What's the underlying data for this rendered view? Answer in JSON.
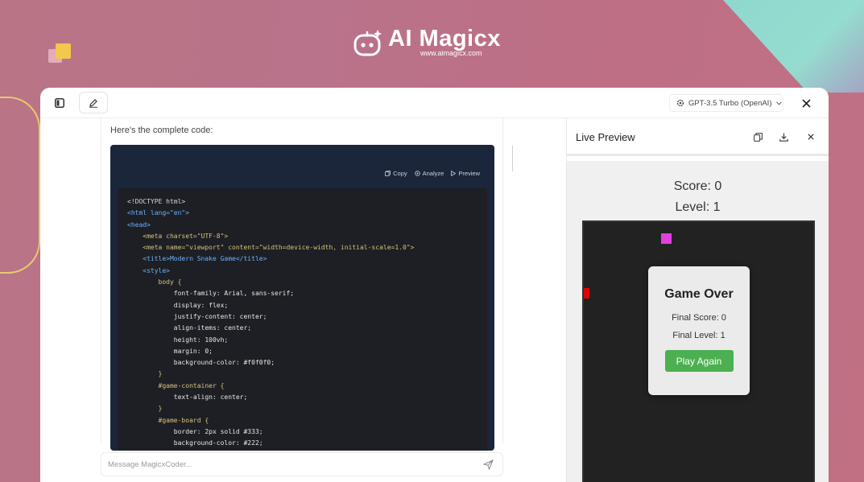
{
  "brand": {
    "name": "AI Magicx",
    "url": "www.aimagicx.com"
  },
  "toolbar": {
    "model_label": "GPT-3.5 Turbo (OpenAI)"
  },
  "chat": {
    "intro": "Here's the complete code:",
    "code_actions": {
      "copy": "Copy",
      "analyze": "Analyze",
      "preview": "Preview"
    },
    "code_lines": [
      "<!DOCTYPE html>",
      "<html lang=\"en\">",
      "<head>",
      "    <meta charset=\"UTF-8\">",
      "    <meta name=\"viewport\" content=\"width=device-width, initial-scale=1.0\">",
      "    <title>Modern Snake Game</title>",
      "    <style>",
      "        body {",
      "            font-family: Arial, sans-serif;",
      "            display: flex;",
      "            justify-content: center;",
      "            align-items: center;",
      "            height: 100vh;",
      "            margin: 0;",
      "            background-color: #f0f0f0;",
      "        }",
      "        #game-container {",
      "            text-align: center;",
      "        }",
      "        #game-board {",
      "            border: 2px solid #333;",
      "            background-color: #222;"
    ]
  },
  "composer": {
    "placeholder": "Message MagicxCoder..."
  },
  "preview": {
    "title": "Live Preview",
    "score": "Score: 0",
    "level": "Level: 1",
    "game_over": {
      "title": "Game Over",
      "final_score": "Final Score: 0",
      "final_level": "Final Level: 1",
      "button": "Play Again"
    }
  },
  "colors": {
    "accent_green": "#4caf50",
    "board": "#222222",
    "food": "#e040e0",
    "snake": "#e00000",
    "code_bg": "#1d1f24"
  }
}
